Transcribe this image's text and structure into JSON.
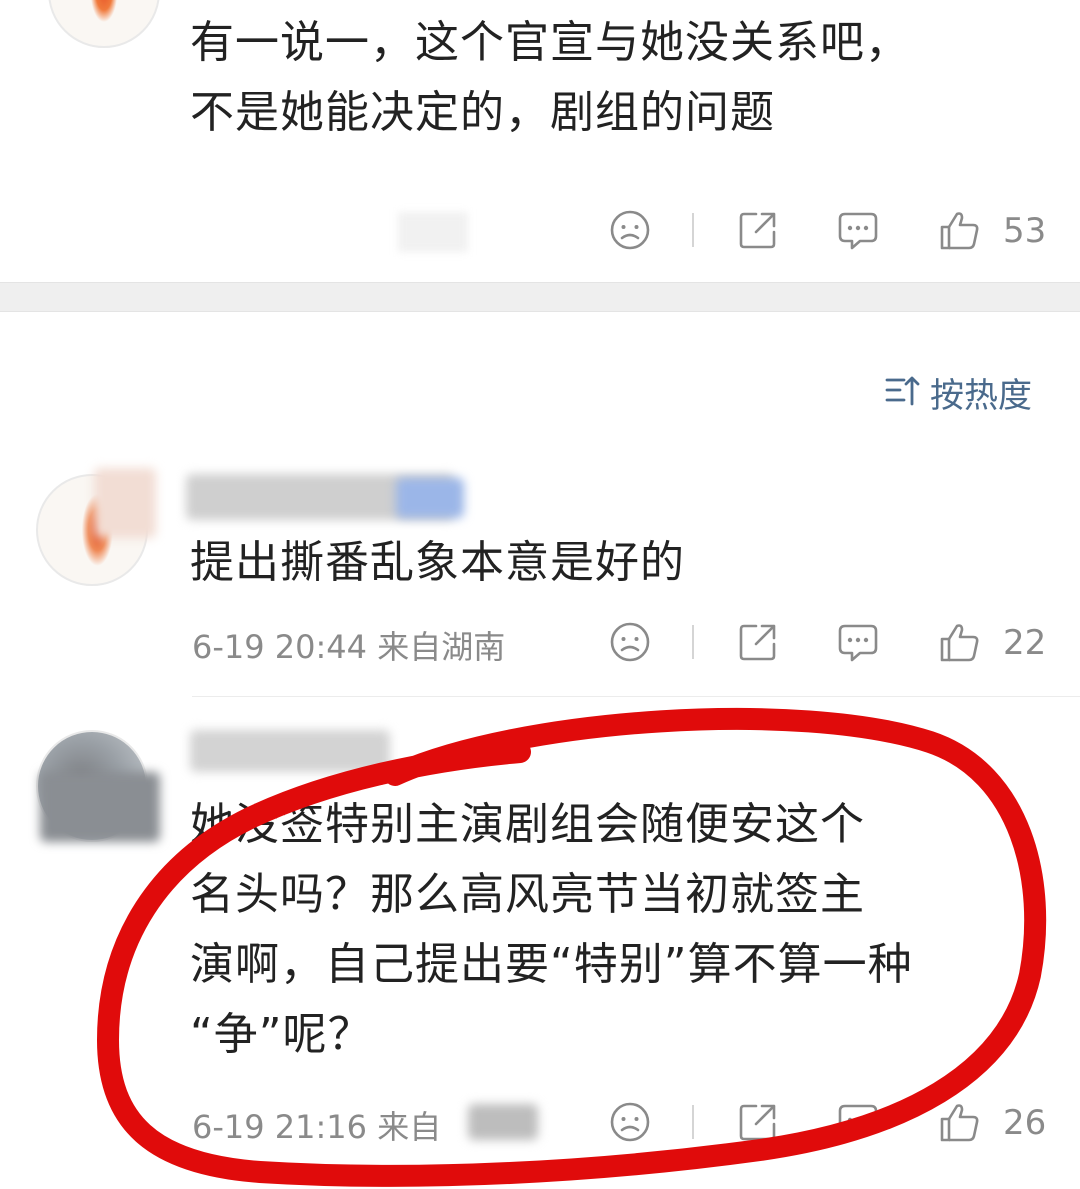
{
  "post": {
    "text_lines": [
      "有一说一，这个官宣与她没关系吧，",
      "不是她能决定的，剧组的问题"
    ],
    "like_count": "53"
  },
  "comments_header": {
    "sort_label": "按热度",
    "sort_icon": "sort-down-arrow-icon"
  },
  "comments": [
    {
      "text_lines": [
        "提出撕番乱象本意是好的"
      ],
      "meta": "6-19 20:44  来自湖南",
      "like_count": "22"
    },
    {
      "text_lines": [
        "她没签特别主演剧组会随便安这个",
        "名头吗？那么高风亮节当初就签主",
        "演啊，自己提出要“特别”算不算一种",
        "“争”呢？"
      ],
      "meta": "6-19 21:16  来自",
      "like_count": "26"
    }
  ],
  "icons": [
    "dislike-face-icon",
    "share-icon",
    "comment-icon",
    "like-thumb-icon"
  ],
  "colors": {
    "text": "#222222",
    "meta": "#8a8a8a",
    "sort": "#4a6a8c",
    "section_gap": "#efefef",
    "annotation": "#e00b0b"
  }
}
